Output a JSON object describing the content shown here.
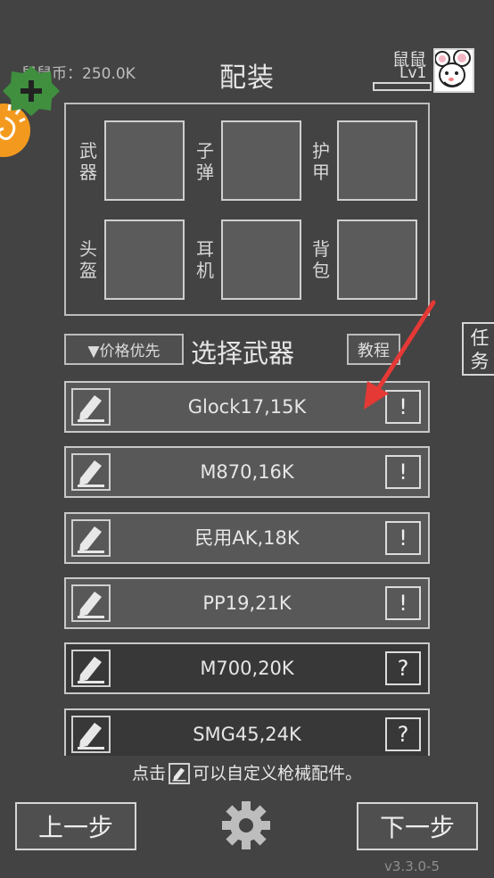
{
  "header": {
    "currency_label": "鼠鼠币：250.0K",
    "title": "配装",
    "player_name": "鼠鼠",
    "player_level": "Lv1"
  },
  "badges": {
    "plus_symbol": "+"
  },
  "loadout": {
    "slots": [
      {
        "label": "武器"
      },
      {
        "label": "子弹"
      },
      {
        "label": "护甲"
      },
      {
        "label": "头盔"
      },
      {
        "label": "耳机"
      },
      {
        "label": "背包"
      }
    ]
  },
  "controls": {
    "sort_label": "▼价格优先",
    "select_title": "选择武器",
    "tutorial_label": "教程",
    "task_label_line1": "任",
    "task_label_line2": "务"
  },
  "weapons": [
    {
      "name": "Glock17,15K",
      "badge": "!",
      "unlocked": true
    },
    {
      "name": "M870,16K",
      "badge": "!",
      "unlocked": true
    },
    {
      "name": "民用AK,18K",
      "badge": "!",
      "unlocked": true
    },
    {
      "name": "PP19,21K",
      "badge": "!",
      "unlocked": true
    },
    {
      "name": "M700,20K",
      "badge": "?",
      "unlocked": false
    },
    {
      "name": "SMG45,24K",
      "badge": "?",
      "unlocked": false
    }
  ],
  "hint": {
    "before": "点击",
    "after": "可以自定义枪械配件。"
  },
  "footer": {
    "prev_label": "上一步",
    "next_label": "下一步",
    "version": "v3.3.0-5"
  },
  "colors": {
    "background": "#434343",
    "arrow": "#e53935",
    "badge_green": "#3f8f3f",
    "badge_orange": "#f39a1e"
  },
  "icons": [
    "plus-icon",
    "swirl-icon",
    "avatar-mouse",
    "edit-pencil-icon",
    "gear-icon",
    "tutorial-arrow"
  ]
}
